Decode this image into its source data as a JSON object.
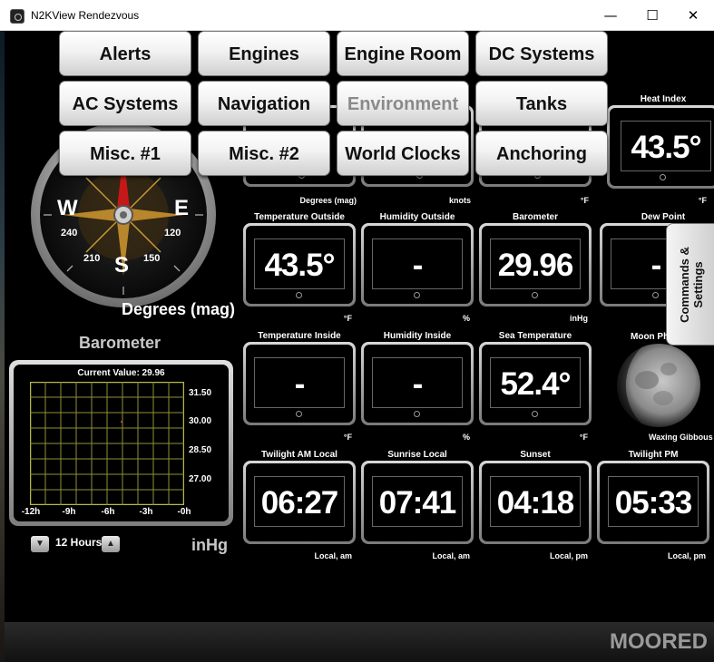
{
  "window": {
    "title": "N2KView Rendezvous",
    "minimize": "—",
    "maximize": "☐",
    "close": "✕"
  },
  "menu": [
    {
      "label": "Alerts",
      "disabled": false
    },
    {
      "label": "Engines",
      "disabled": false
    },
    {
      "label": "Engine Room",
      "disabled": false
    },
    {
      "label": "DC Systems",
      "disabled": false
    },
    {
      "label": "AC Systems",
      "disabled": false
    },
    {
      "label": "Navigation",
      "disabled": false
    },
    {
      "label": "Environment",
      "disabled": true
    },
    {
      "label": "Tanks",
      "disabled": false
    },
    {
      "label": "Misc. #1",
      "disabled": false
    },
    {
      "label": "Misc. #2",
      "disabled": false
    },
    {
      "label": "World Clocks",
      "disabled": false
    },
    {
      "label": "Anchoring",
      "disabled": false
    }
  ],
  "compass": {
    "caption": "Degrees (mag)",
    "cardinals": {
      "W": "W",
      "E": "E",
      "S": "S"
    },
    "degrees": {
      "d240": "240",
      "d210": "210",
      "d120": "120",
      "d150": "150"
    }
  },
  "top_units": {
    "degrees": "Degrees (mag)",
    "knots": "knots",
    "f1": "°F",
    "f2": "°F"
  },
  "heat_index": {
    "label": "Heat Index",
    "value": "43.5°",
    "unit": "°F"
  },
  "gauges": [
    {
      "label": "Temperature Outside",
      "value": "43.5°",
      "unit": "°F"
    },
    {
      "label": "Humidity Outside",
      "value": "-",
      "unit": "%"
    },
    {
      "label": "Barometer",
      "value": "29.96",
      "unit": "inHg"
    },
    {
      "label": "Dew Point",
      "value": "-",
      "unit": ""
    },
    {
      "label": "Temperature Inside",
      "value": "-",
      "unit": "°F"
    },
    {
      "label": "Humidity Inside",
      "value": "-",
      "unit": "%"
    },
    {
      "label": "Sea Temperature",
      "value": "52.4°",
      "unit": "°F"
    },
    {
      "label": "Twilight AM Local",
      "value": "06:27",
      "unit": "Local, am"
    },
    {
      "label": "Sunrise Local",
      "value": "07:41",
      "unit": "Local, am"
    },
    {
      "label": "Sunset",
      "value": "04:18",
      "unit": "Local, pm"
    },
    {
      "label": "Twilight PM",
      "value": "05:33",
      "unit": "Local, pm"
    }
  ],
  "moon": {
    "label": "Moon Ph",
    "phase": "Waxing Gibbous"
  },
  "commands": {
    "label": "Commands &\nSettings"
  },
  "barometer": {
    "title": "Barometer",
    "current": "Current Value: 29.96",
    "y_ticks": [
      "31.50",
      "30.00",
      "28.50",
      "27.00"
    ],
    "x_ticks": [
      "-12h",
      "-9h",
      "-6h",
      "-3h",
      "-0h"
    ],
    "range": "12 Hours",
    "unit": "inHg",
    "down": "▼",
    "up": "▲"
  },
  "status": {
    "label": "MOORED"
  }
}
